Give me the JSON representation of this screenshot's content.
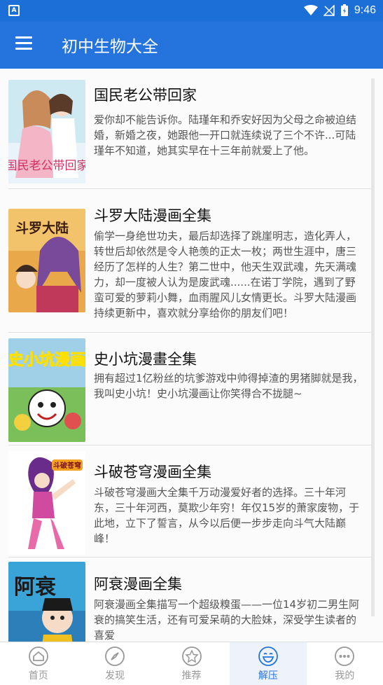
{
  "status": {
    "time": "9:46",
    "app_icon": "A"
  },
  "appbar": {
    "title": "初中生物大全"
  },
  "items": [
    {
      "title": "国民老公带回家",
      "desc": "爱你却不能告诉你。陆瑾年和乔安好因为父母之命被迫结婚，新婚之夜，她跟他一开口就连续说了三个不许...可陆瑾年不知道，她其实早在十三年前就爱上了他。",
      "cover_text": "国民老公带回家"
    },
    {
      "title": "斗罗大陆漫画全集",
      "desc": "偷学一身绝世功夫，最后却选择了跳崖明志，造化弄人，转世后却依然是令人艳羡的正太一枚；两世生涯中，唐三经历了怎样的人生？第二世中，他天生双武魂，先天满魂力，却一度被人认为是废武魂......在诺丁学院，遇到了野蛮可爱的萝莉小舞，血雨腥风儿女情更长。斗罗大陆漫画持续更新中，喜欢就分享给你的朋友们吧！",
      "cover_text": "斗罗大陆"
    },
    {
      "title": "史小坑漫畫全集",
      "desc": "拥有超过1亿粉丝的坑爹游戏中帅得掉渣的男猪脚就是我，我叫史小坑！史小坑漫画让你笑得合不拢腿~",
      "cover_text": "史小坑漫画"
    },
    {
      "title": "斗破苍穹漫画全集",
      "desc": " 斗破苍穹漫画大全集千万动漫爱好者的选择。三十年河东，三十年河西，莫欺少年穷！年仅15岁的萧家废物，于此地，立下了誓言，从今以后便一步步走向斗气大陆巅峰！",
      "cover_text": "斗破苍穹"
    },
    {
      "title": "阿衰漫画全集",
      "desc": "阿衰漫画全集描写一个超级糗蛋——一位14岁初二男生阿衰的搞笑生活，还有可爱呆萌的大脸妹，深受学生读者的喜爱",
      "cover_text": "阿衰"
    }
  ],
  "tabs": [
    {
      "label": "首页",
      "icon": "home-icon"
    },
    {
      "label": "发现",
      "icon": "compass-icon"
    },
    {
      "label": "推荐",
      "icon": "star-icon"
    },
    {
      "label": "解压",
      "icon": "smile-icon",
      "active": true
    },
    {
      "label": "我的",
      "icon": "more-icon"
    }
  ],
  "colors": {
    "primary": "#2573dd",
    "status": "#1d6fd8",
    "tab_inactive": "#999999"
  }
}
